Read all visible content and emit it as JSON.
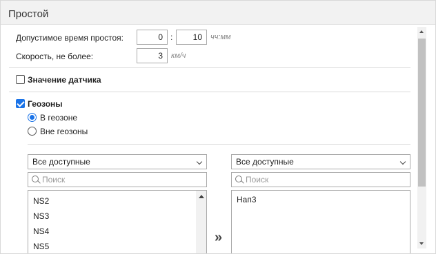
{
  "header": {
    "title": "Простой"
  },
  "idle_time": {
    "label": "Допустимое время простоя:",
    "hours": "0",
    "minutes": "10",
    "unit": "чч:мм",
    "separator": ":"
  },
  "speed": {
    "label": "Скорость, не более:",
    "value": "3",
    "unit": "км/ч"
  },
  "sensor": {
    "label": "Значение датчика",
    "checked": false
  },
  "geozones": {
    "label": "Геозоны",
    "checked": true,
    "options": [
      {
        "label": "В геозоне",
        "selected": true
      },
      {
        "label": "Вне геозоны",
        "selected": false
      }
    ]
  },
  "left_list": {
    "filter": "Все доступные",
    "search_placeholder": "Поиск",
    "items": [
      "NS2",
      "NS3",
      "NS4",
      "NS5"
    ]
  },
  "move_button": {
    "label": "»"
  },
  "right_list": {
    "filter": "Все доступные",
    "search_placeholder": "Поиск",
    "items": [
      "Нап3"
    ]
  },
  "colors": {
    "accent": "#1a73e8",
    "header_bg": "#f2f2f2",
    "border": "#a9a9a9"
  }
}
